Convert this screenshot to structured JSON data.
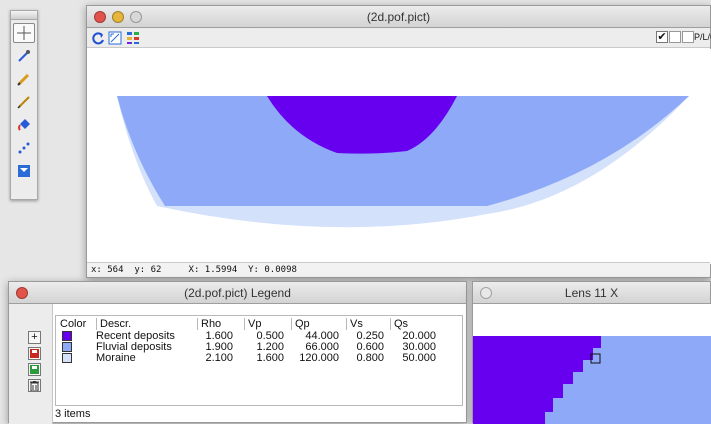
{
  "palette": {
    "tools": [
      {
        "icon": "crosshair-icon",
        "selected": true
      },
      {
        "icon": "eyedropper-icon",
        "selected": false
      },
      {
        "icon": "pencil-icon",
        "selected": false
      },
      {
        "icon": "pen-icon",
        "selected": false
      },
      {
        "icon": "paint-bucket-icon",
        "selected": false
      },
      {
        "icon": "spray-icon",
        "selected": false
      },
      {
        "icon": "layer-icon",
        "selected": false
      }
    ]
  },
  "main_window": {
    "title": "(2d.pof.pict)",
    "toolbar_right_label": "P/L/C",
    "status_text": "x: 564  y: 62     X: 1.5994  Y: 0.0098"
  },
  "legend_window": {
    "title": "(2d.pof.pict) Legend",
    "columns": [
      "Color",
      "Descr.",
      "Rho",
      "Vp",
      "Qp",
      "Vs",
      "Qs"
    ],
    "rows": [
      {
        "color": "#6600ee",
        "descr": "Recent deposits",
        "rho": "1.600",
        "vp": "0.500",
        "qp": "44.000",
        "vs": "0.250",
        "qs": "20.000"
      },
      {
        "color": "#8ea9f8",
        "descr": "Fluvial deposits",
        "rho": "1.900",
        "vp": "1.200",
        "qp": "66.000",
        "vs": "0.600",
        "qs": "30.000"
      },
      {
        "color": "#d4e1fb",
        "descr": "Moraine",
        "rho": "2.100",
        "vp": "1.600",
        "qp": "120.000",
        "vs": "0.800",
        "qs": "50.000"
      }
    ],
    "footer": "3 items"
  },
  "lens_window": {
    "title": "Lens 11 X"
  }
}
